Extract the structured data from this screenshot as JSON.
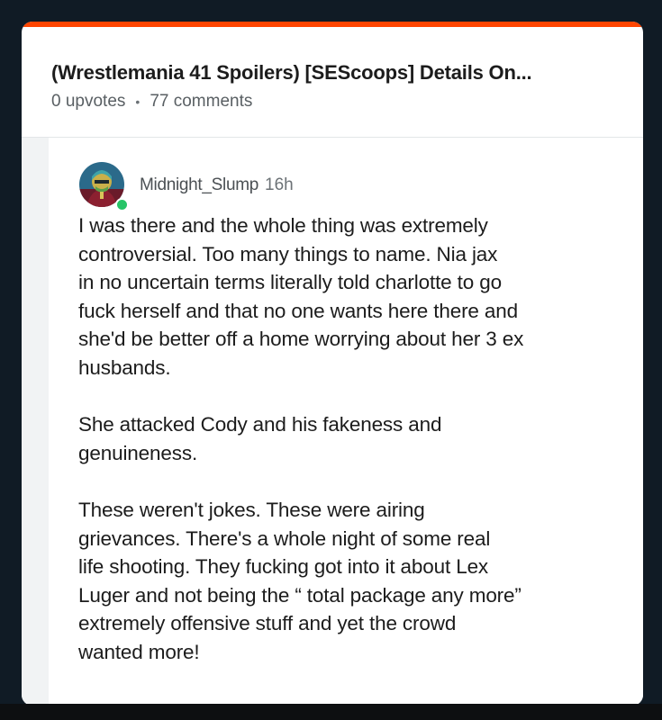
{
  "theme": {
    "accent": "#ff4500",
    "background": "#101b25",
    "card": "#ffffff",
    "online_status": "#27c467"
  },
  "post": {
    "title": "(Wrestlemania 41 Spoilers) [SEScoops] Details On...",
    "upvotes": "0 upvotes",
    "separator": "•",
    "comments": "77 comments"
  },
  "comment": {
    "avatar_icon": "avatar-icon",
    "username": "Midnight_Slump",
    "timestamp": "16h",
    "paragraphs": [
      "I was there and the whole thing was extremely\ncontroversial. Too many things to name. Nia jax\nin no uncertain terms literally told charlotte to go\nfuck herself and that no one wants here there and\nshe'd be better off a home worrying about her 3 ex\nhusbands.",
      "She attacked Cody and his fakeness and\ngenuineness.",
      "These weren't jokes. These were airing\ngrievances. There's a whole night of some real\nlife shooting. They fucking got into it about Lex\nLuger and not being the “ total package any more”\nextremely offensive stuff and yet the crowd\nwanted more!"
    ]
  }
}
